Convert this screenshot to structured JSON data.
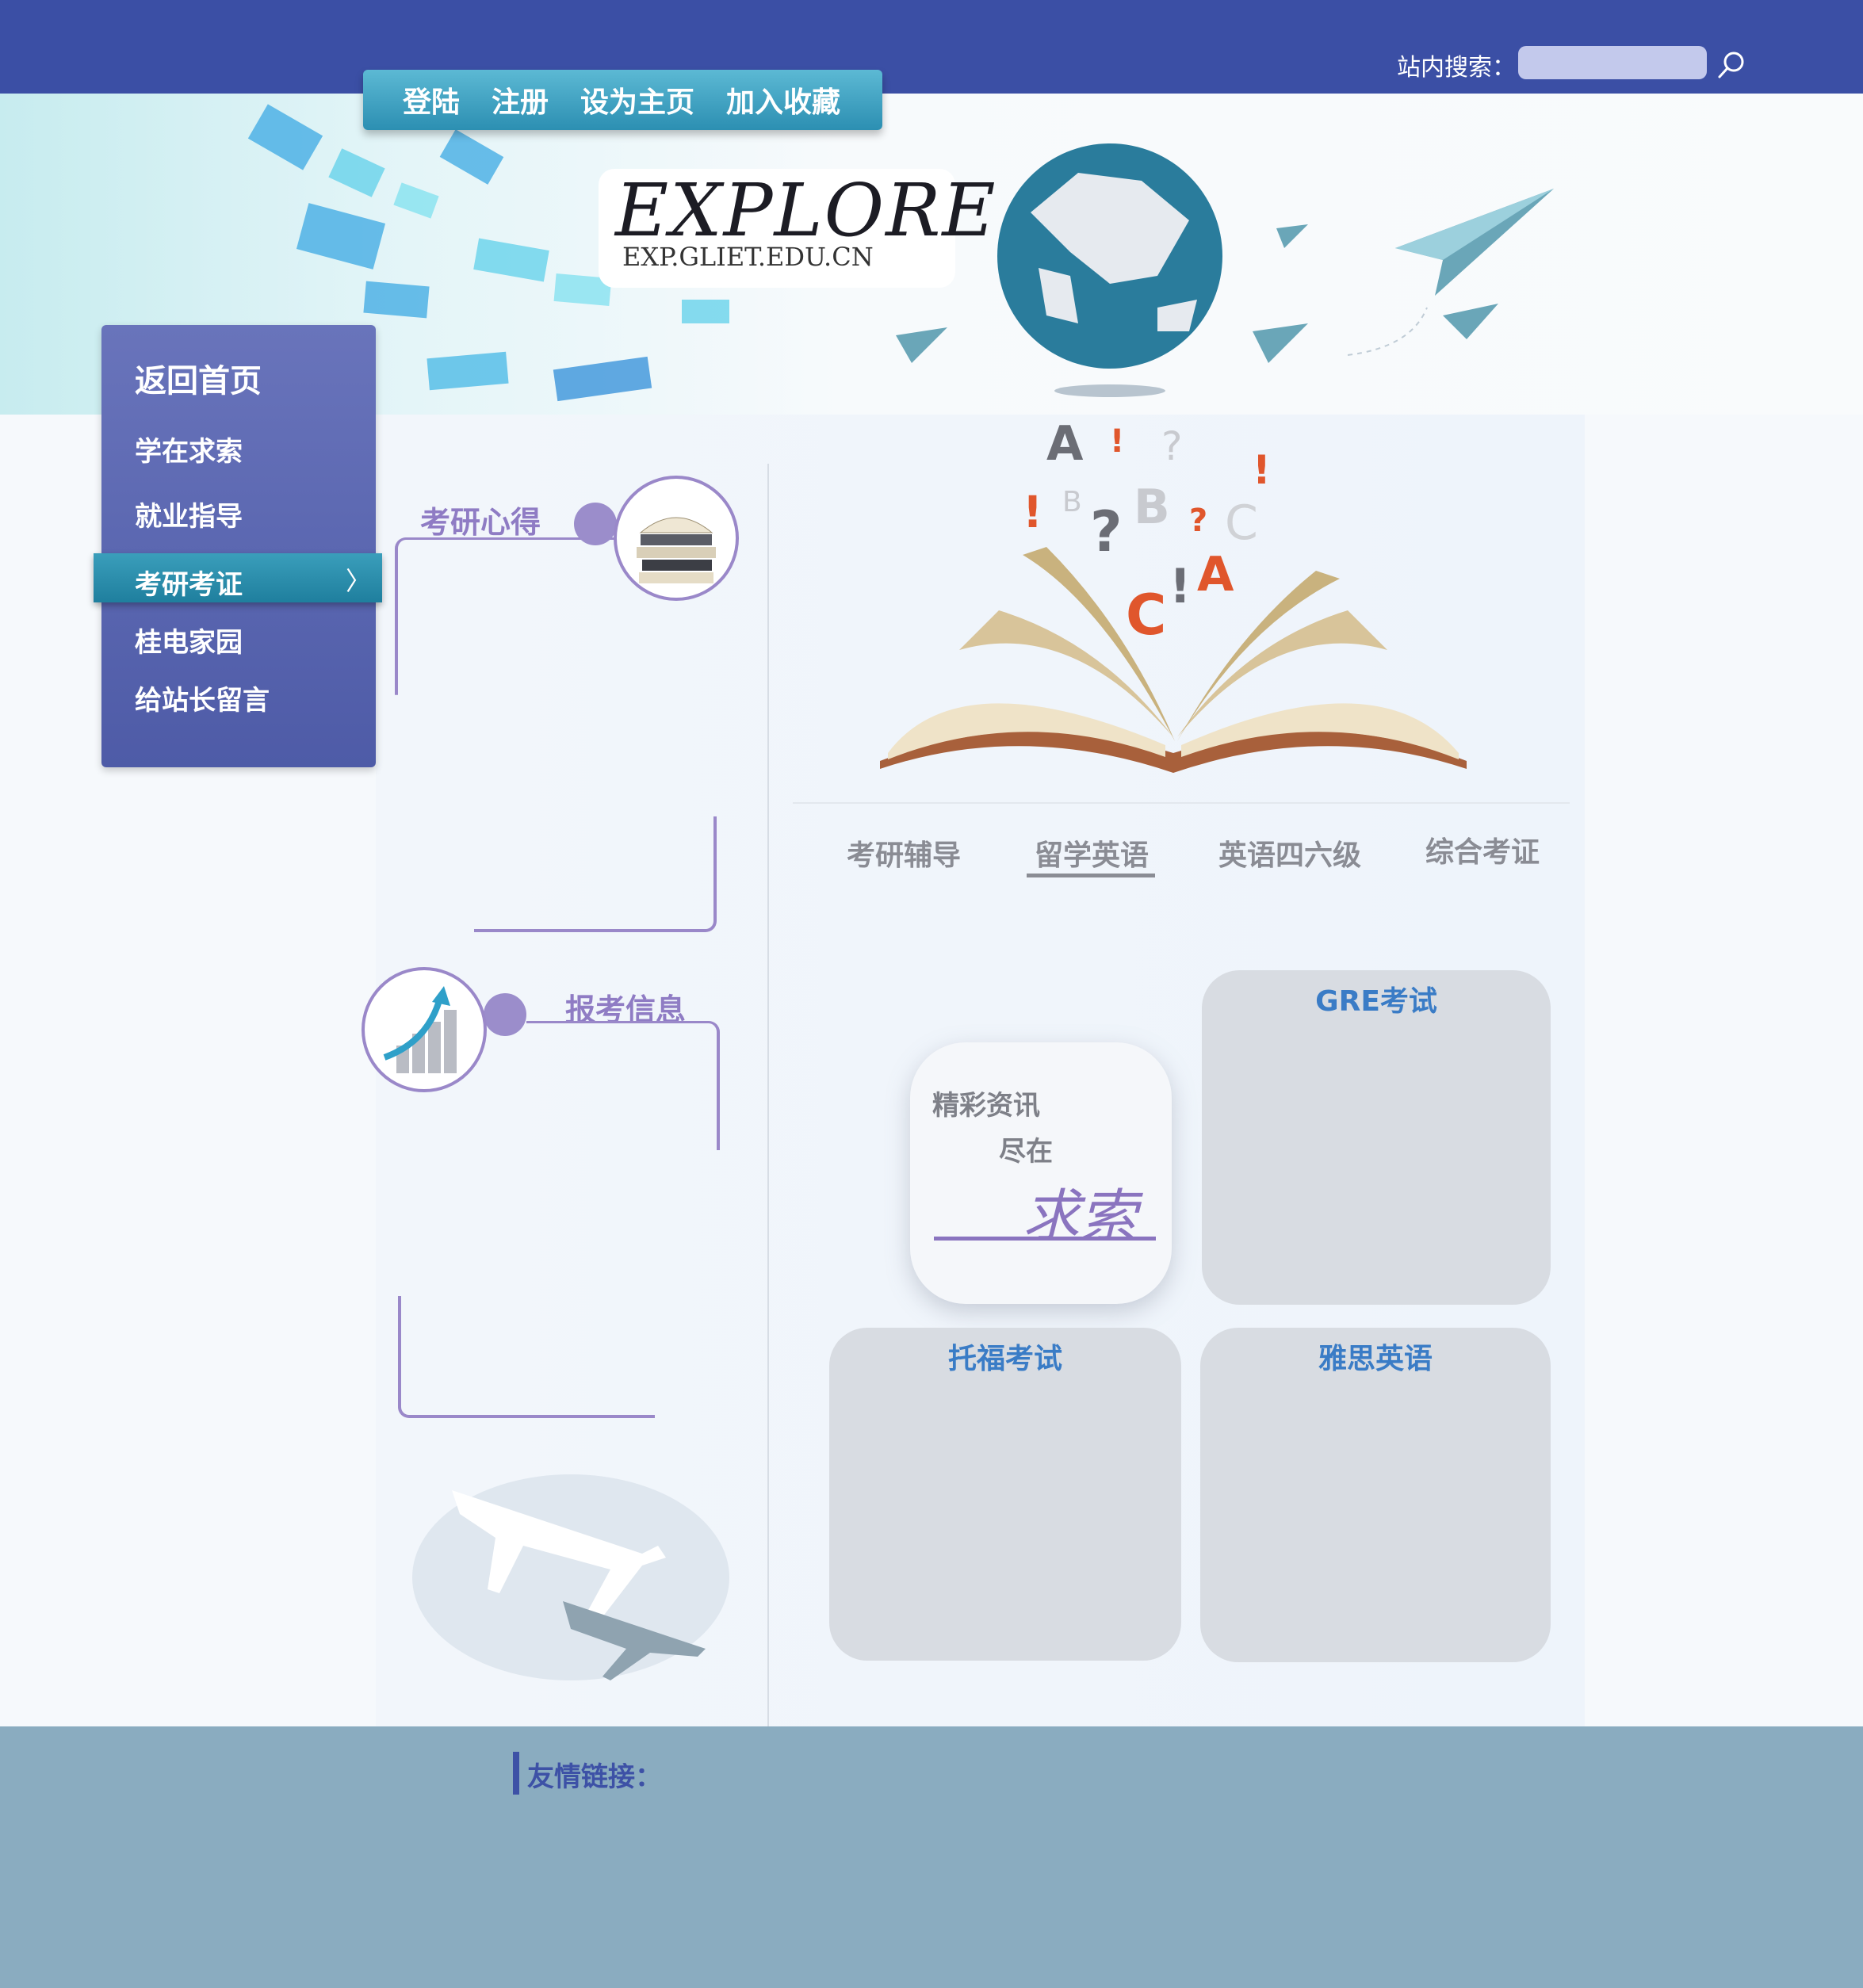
{
  "header": {
    "search_label": "站内搜索：",
    "search_placeholder": "",
    "nav": [
      "登陆",
      "注册",
      "设为主页",
      "加入收藏"
    ]
  },
  "logo": {
    "title": "EXPLORE",
    "url": "EXP.GLIET.EDU.CN"
  },
  "sidebar": {
    "items": [
      {
        "label": "返回首页"
      },
      {
        "label": "学在求索"
      },
      {
        "label": "就业指导"
      },
      {
        "label": "考研考证",
        "active": true
      },
      {
        "label": "桂电家园"
      },
      {
        "label": "给站长留言"
      }
    ]
  },
  "sections": {
    "experience": "考研心得",
    "exam_info": "报考信息"
  },
  "tabs": [
    "考研辅导",
    "留学英语",
    "英语四六级",
    "综合考证"
  ],
  "active_tab": "留学英语",
  "promo": {
    "line1": "精彩资讯",
    "line2": "尽在",
    "line3": "求索"
  },
  "cards": {
    "gre": "GRE考试",
    "toefl": "托福考试",
    "ielts": "雅思英语"
  },
  "footer": {
    "links_label": "友情链接："
  },
  "colors": {
    "topbar": "#3b4fa5",
    "accent_purple": "#9a88c9",
    "card_title": "#3a7cc6",
    "footer": "#8aacc0"
  }
}
